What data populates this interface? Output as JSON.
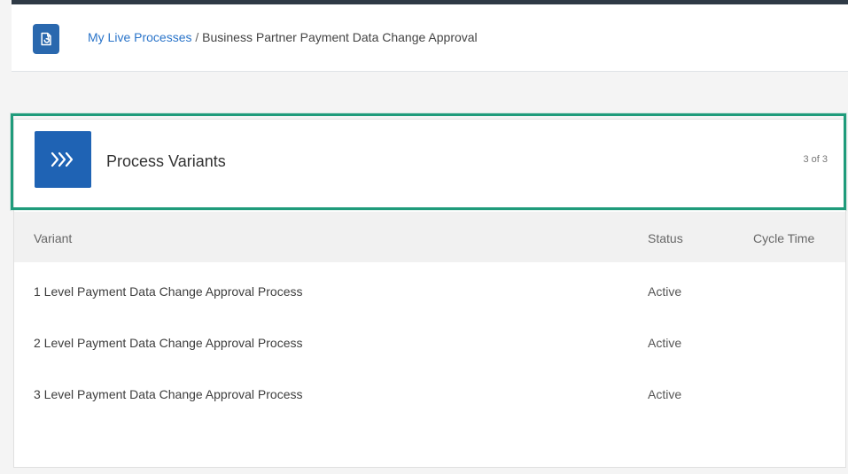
{
  "breadcrumb": {
    "link": "My Live Processes",
    "separator": " / ",
    "current": "Business Partner Payment Data Change Approval"
  },
  "card": {
    "title": "Process Variants",
    "count": "3 of 3",
    "icon": "chevron-right-triple-icon"
  },
  "table": {
    "columns": [
      "Variant",
      "Status",
      "Cycle Time"
    ],
    "rows": [
      {
        "name": "1 Level Payment Data Change Approval Process",
        "status": "Active",
        "cycle_time": ""
      },
      {
        "name": "2 Level Payment Data Change Approval Process",
        "status": "Active",
        "cycle_time": ""
      },
      {
        "name": "3 Level Payment Data Change Approval Process",
        "status": "Active",
        "cycle_time": ""
      }
    ]
  },
  "icons": {
    "app": "process-icon",
    "variants": "chevron-right-triple-icon"
  },
  "colors": {
    "accent": "#2a74c9",
    "icon_bg": "#1f63b4",
    "highlight": "#1f9b7b",
    "topline": "#2f3a46"
  }
}
